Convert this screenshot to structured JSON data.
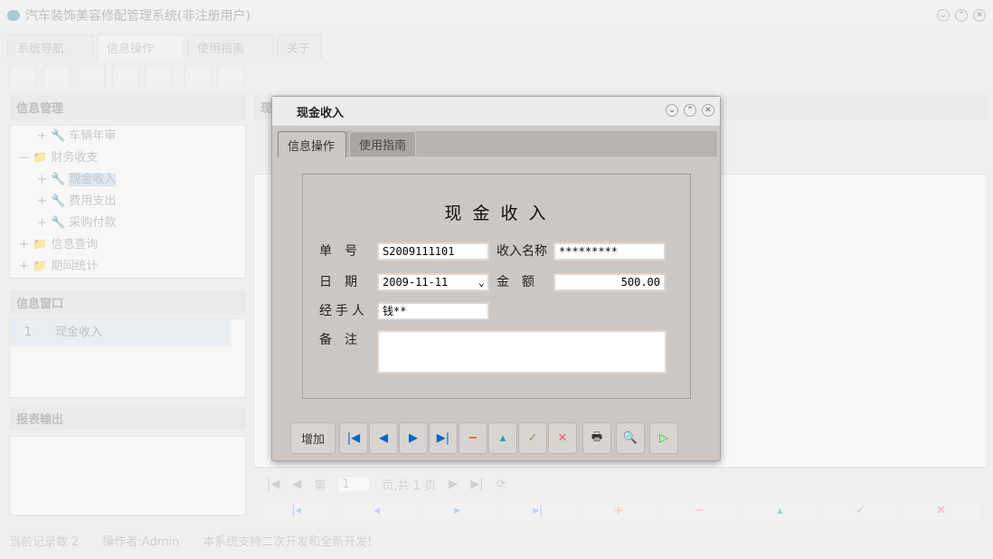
{
  "window": {
    "title": "汽车装饰美容修配管理系统(非注册用户)"
  },
  "main_tabs": [
    {
      "label": "系统导航"
    },
    {
      "label": "信息操作"
    },
    {
      "label": "使用指南"
    },
    {
      "label": "关于"
    }
  ],
  "left": {
    "info_mgmt": {
      "title": "信息管理",
      "tree": [
        {
          "label": "车辆年审",
          "level": 2
        },
        {
          "label": "财务收支",
          "level": 1
        },
        {
          "label": "现金收入",
          "level": 2,
          "selected": true
        },
        {
          "label": "费用支出",
          "level": 2
        },
        {
          "label": "采购付款",
          "level": 2
        },
        {
          "label": "信息查询",
          "level": 1
        },
        {
          "label": "期间统计",
          "level": 1
        }
      ]
    },
    "info_window": {
      "title": "信息窗口",
      "rows": [
        {
          "num": "1",
          "label": "现金收入"
        }
      ]
    },
    "report": {
      "title": "报表输出"
    }
  },
  "right": {
    "title": "现"
  },
  "pager": {
    "page_prefix": "第",
    "page": "1",
    "page_suffix": "页,共 1 页"
  },
  "status": {
    "records": "当前记录数 2",
    "operator": "操作者:Admin",
    "note": "本系统支持二次开发和全新开发!"
  },
  "dialog": {
    "title": "现金收入",
    "tabs": [
      {
        "label": "信息操作"
      },
      {
        "label": "使用指南"
      }
    ],
    "form_title": "现 金 收 入",
    "fields": {
      "number": {
        "label": "单　号",
        "value": "S2009111101"
      },
      "income_name": {
        "label": "收入名称",
        "value": "*********"
      },
      "date": {
        "label": "日　期",
        "value": "2009-11-11"
      },
      "amount": {
        "label": "金　额",
        "value": "500.00"
      },
      "handler": {
        "label": "经手人",
        "value": "钱**"
      },
      "remark": {
        "label": "备　注",
        "value": ""
      }
    },
    "add_label": "增加"
  }
}
